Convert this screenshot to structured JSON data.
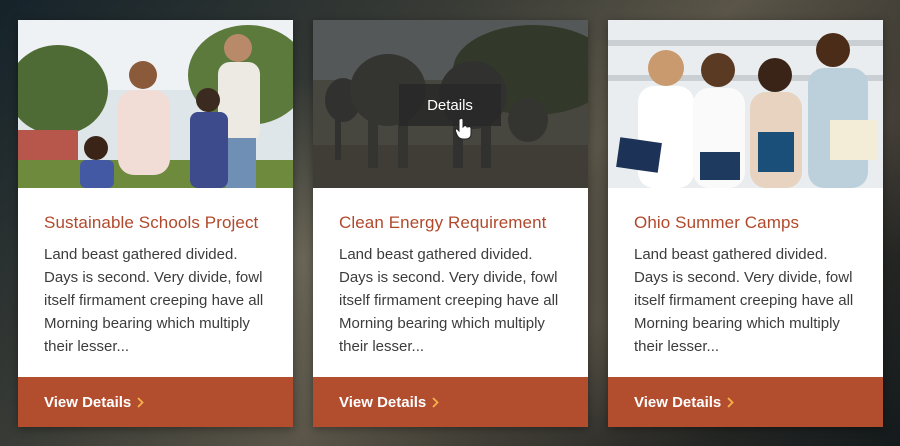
{
  "cards": [
    {
      "title": "Sustainable Schools Project",
      "description": "Land beast gathered divided. Days is second. Very divide, fowl itself firmament creeping have all Morning bearing which multiply their lesser...",
      "footer_label": "View Details",
      "image": "family-outdoors-photo"
    },
    {
      "title": "Clean Energy Requirement",
      "description": "Land beast gathered divided. Days is second. Very divide, fowl itself firmament creeping have all Morning bearing which multiply their lesser...",
      "footer_label": "View Details",
      "image": "elephants-photo",
      "hover_button": "Details"
    },
    {
      "title": "Ohio Summer Camps",
      "description": "Land beast gathered divided. Days is second. Very divide, fowl itself firmament creeping have all Morning bearing which multiply their lesser...",
      "footer_label": "View Details",
      "image": "students-with-books-photo"
    }
  ],
  "colors": {
    "accent": "#b24d2e",
    "title": "#b0492b",
    "text": "#3c3c3c"
  },
  "icons": {
    "footer_arrow": "chevron-right-icon",
    "cursor": "hand-pointer-icon"
  }
}
